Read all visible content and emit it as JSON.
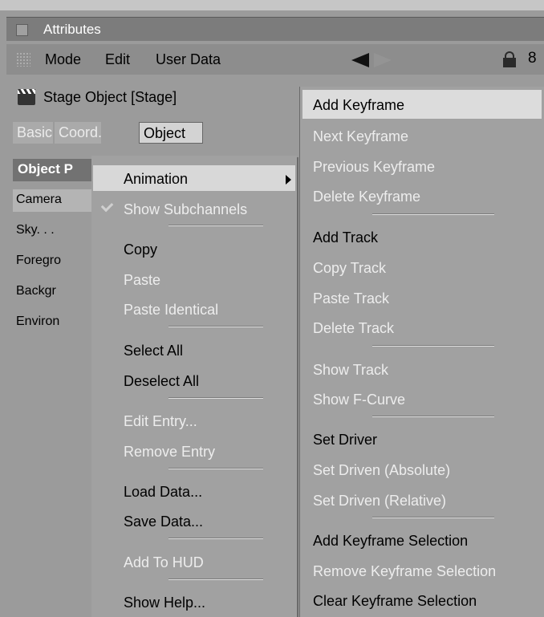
{
  "window": {
    "title": "Attributes"
  },
  "menubar": {
    "items": [
      "Mode",
      "Edit",
      "User Data"
    ],
    "glyph": "8"
  },
  "object": {
    "title": "Stage Object [Stage]"
  },
  "tabs": {
    "basic": "Basic",
    "coord": "Coord.",
    "object": "Object"
  },
  "properties": {
    "header": "Object P",
    "rows": [
      "Camera",
      "Sky. . .",
      "Foregro",
      "Backgr",
      "Environ"
    ]
  },
  "context_menu": {
    "animation": "Animation",
    "show_subchannels": "Show Subchannels",
    "copy": "Copy",
    "paste": "Paste",
    "paste_identical": "Paste Identical",
    "select_all": "Select All",
    "deselect_all": "Deselect All",
    "edit_entry": "Edit Entry...",
    "remove_entry": "Remove Entry",
    "load_data": "Load Data...",
    "save_data": "Save Data...",
    "add_to_hud": "Add To HUD",
    "show_help": "Show Help..."
  },
  "animation_submenu": {
    "add_keyframe": "Add Keyframe",
    "next_keyframe": "Next Keyframe",
    "previous_keyframe": "Previous Keyframe",
    "delete_keyframe": "Delete Keyframe",
    "add_track": "Add Track",
    "copy_track": "Copy Track",
    "paste_track": "Paste Track",
    "delete_track": "Delete Track",
    "show_track": "Show Track",
    "show_fcurve": "Show F-Curve",
    "set_driver": "Set Driver",
    "set_driven_absolute": "Set Driven (Absolute)",
    "set_driven_relative": "Set Driven (Relative)",
    "add_keyframe_selection": "Add Keyframe Selection",
    "remove_keyframe_selection": "Remove Keyframe Selection",
    "clear_keyframe_selection": "Clear Keyframe Selection"
  },
  "colors": {
    "background": "#9b9b9b",
    "titlebar": "#7c7c7c",
    "menu_highlight": "#d8d8d8",
    "disabled_text": "#ededed"
  }
}
